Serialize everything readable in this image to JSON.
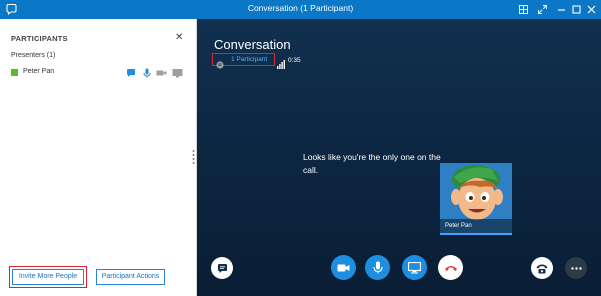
{
  "window": {
    "title": "Conversation (1 Participant)"
  },
  "panel": {
    "title": "PARTICIPANTS",
    "close_glyph": "✕",
    "presenters_heading": "Presenters (1)",
    "participants": [
      {
        "name": "Peter Pan",
        "presence_color": "#5fb832"
      }
    ],
    "invite_label": "Invite More People",
    "actions_label": "Participant Actions"
  },
  "stage": {
    "title": "Conversation",
    "participant_link": "1 Participant",
    "timer": "0:35",
    "message": "Looks like you're the only one on the call.",
    "avatar_name": "Peter Pan"
  },
  "icons": {
    "app": "skype-icon",
    "snap": "snap-icon",
    "fullscreen": "fullscreen-icon",
    "minimize": "minimize-icon",
    "maximize": "maximize-icon",
    "close": "close-icon"
  },
  "colors": {
    "titlebar": "#0b77c7",
    "accent": "#1e8fe0",
    "link": "#55b4ff",
    "highlight_box": "#d9262e",
    "hangup": "#e03c31"
  }
}
